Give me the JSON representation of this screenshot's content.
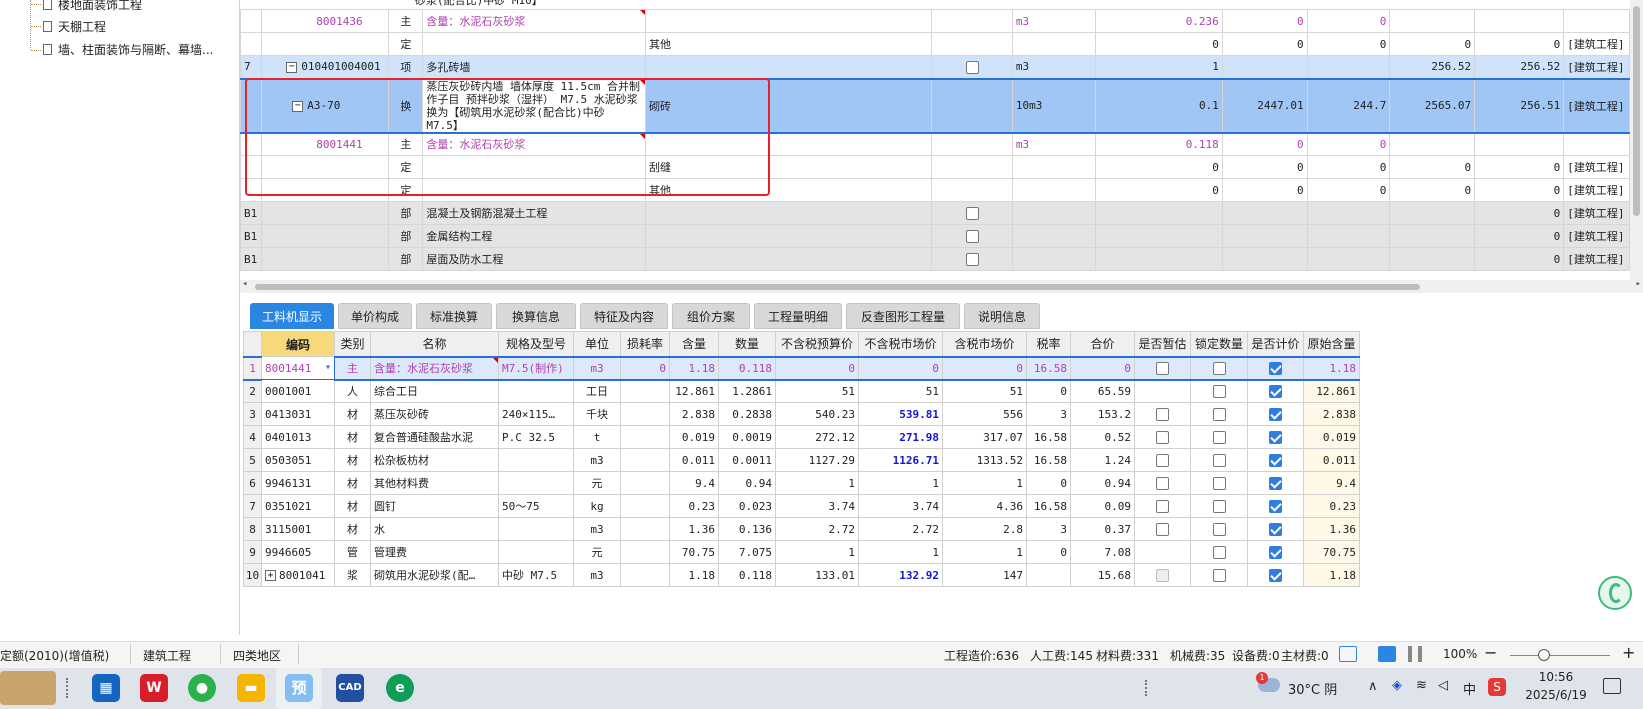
{
  "left_tree": {
    "items": [
      "楼地面装饰工程",
      "天棚工程",
      "墙、柱面装饰与隔断、幕墙..."
    ]
  },
  "top_grid": {
    "rows": [
      {
        "no": "",
        "code": "8001436",
        "type": "主",
        "name": "含量：水泥石灰砂浆",
        "spec": "",
        "unit": "m3",
        "qty": "0.236",
        "v1": "0",
        "v2": "0",
        "v3": "",
        "v4": "",
        "cat": "",
        "style": "sub"
      },
      {
        "no": "",
        "code": "",
        "type": "定",
        "name": "",
        "spec": "其他",
        "unit": "",
        "qty": "0",
        "v1": "0",
        "v2": "0",
        "v3": "0",
        "v4": "0",
        "cat": "[建筑工程]",
        "style": "normal"
      },
      {
        "no": "7",
        "code": "010401004001",
        "type": "项",
        "name": "多孔砖墙",
        "spec": "",
        "unit": "m3",
        "qty": "1",
        "v1": "",
        "v2": "",
        "v3": "256.52",
        "v4": "256.52",
        "cat": "[建筑工程]",
        "style": "blue",
        "check": true
      },
      {
        "no": "",
        "code": "A3-70",
        "type": "换",
        "name": "蒸压灰砂砖内墙 墙体厚度 11.5cm 合并制作子目 预拌砂浆（湿拌） M7.5 水泥砂浆 换为【砌筑用水泥砂浆(配合比)中砂 M7.5】",
        "spec": "砌砖",
        "unit": "10m3",
        "qty": "0.1",
        "v1": "2447.01",
        "v2": "244.7",
        "v3": "2565.07",
        "v4": "256.51",
        "cat": "[建筑工程]",
        "style": "selected"
      },
      {
        "no": "",
        "code": "8001441",
        "type": "主",
        "name": "含量：水泥石灰砂浆",
        "spec": "",
        "unit": "m3",
        "qty": "0.118",
        "v1": "0",
        "v2": "0",
        "v3": "",
        "v4": "",
        "cat": "",
        "style": "sub"
      },
      {
        "no": "",
        "code": "",
        "type": "定",
        "name": "",
        "spec": "刮缝",
        "unit": "",
        "qty": "0",
        "v1": "0",
        "v2": "0",
        "v3": "0",
        "v4": "0",
        "cat": "[建筑工程]",
        "style": "normal"
      },
      {
        "no": "",
        "code": "",
        "type": "定",
        "name": "",
        "spec": "其他",
        "unit": "",
        "qty": "0",
        "v1": "0",
        "v2": "0",
        "v3": "0",
        "v4": "0",
        "cat": "[建筑工程]",
        "style": "normal"
      },
      {
        "no": "B1",
        "code": "",
        "type": "部",
        "name": "混凝土及钢筋混凝土工程",
        "spec": "",
        "unit": "",
        "qty": "",
        "v1": "",
        "v2": "",
        "v3": "",
        "v4": "0",
        "cat": "[建筑工程]",
        "style": "gray",
        "check": true
      },
      {
        "no": "B1",
        "code": "",
        "type": "部",
        "name": "金属结构工程",
        "spec": "",
        "unit": "",
        "qty": "",
        "v1": "",
        "v2": "",
        "v3": "",
        "v4": "0",
        "cat": "[建筑工程]",
        "style": "gray",
        "check": true
      },
      {
        "no": "B1",
        "code": "",
        "type": "部",
        "name": "屋面及防水工程",
        "spec": "",
        "unit": "",
        "qty": "",
        "v1": "",
        "v2": "",
        "v3": "",
        "v4": "0",
        "cat": "[建筑工程]",
        "style": "gray",
        "check": true
      }
    ],
    "top_fragment": "砂浆(配合比)中砂 M10】"
  },
  "tabs": [
    "工料机显示",
    "单价构成",
    "标准换算",
    "换算信息",
    "特征及内容",
    "组价方案",
    "工程量明细",
    "反查图形工程量",
    "说明信息"
  ],
  "bottom_grid": {
    "headers": [
      "",
      "编码",
      "类别",
      "名称",
      "规格及型号",
      "单位",
      "损耗率",
      "含量",
      "数量",
      "不含税预算价",
      "不含税市场价",
      "含税市场价",
      "税率",
      "合价",
      "是否暂估",
      "锁定数量",
      "是否计价",
      "原始含量"
    ],
    "rows": [
      {
        "n": "1",
        "code": "8001441",
        "type": "主",
        "name": "含量：水泥石灰砂浆",
        "spec": "M7.5(制作)",
        "unit": "m3",
        "loss": "0",
        "content": "1.18",
        "qty": "0.118",
        "budget": "0",
        "market": "0",
        "taxmarket": "0",
        "rate": "16.58",
        "total": "0",
        "est": false,
        "lock": false,
        "price": true,
        "orig": "1.18"
      },
      {
        "n": "2",
        "code": "0001001",
        "type": "人",
        "name": "综合工日",
        "spec": "",
        "unit": "工日",
        "loss": "",
        "content": "12.861",
        "qty": "1.2861",
        "budget": "51",
        "market": "51",
        "taxmarket": "51",
        "rate": "0",
        "total": "65.59",
        "est": null,
        "lock": false,
        "price": true,
        "orig": "12.861"
      },
      {
        "n": "3",
        "code": "0413031",
        "type": "材",
        "name": "蒸压灰砂砖",
        "spec": "240×115…",
        "unit": "千块",
        "loss": "",
        "content": "2.838",
        "qty": "0.2838",
        "budget": "540.23",
        "market": "539.81",
        "taxmarket": "556",
        "rate": "3",
        "total": "153.2",
        "est": false,
        "lock": false,
        "price": true,
        "orig": "2.838",
        "bold": true
      },
      {
        "n": "4",
        "code": "0401013",
        "type": "材",
        "name": "复合普通硅酸盐水泥",
        "spec": "P.C 32.5",
        "unit": "t",
        "loss": "",
        "content": "0.019",
        "qty": "0.0019",
        "budget": "272.12",
        "market": "271.98",
        "taxmarket": "317.07",
        "rate": "16.58",
        "total": "0.52",
        "est": false,
        "lock": false,
        "price": true,
        "orig": "0.019",
        "bold": true
      },
      {
        "n": "5",
        "code": "0503051",
        "type": "材",
        "name": "松杂板枋材",
        "spec": "",
        "unit": "m3",
        "loss": "",
        "content": "0.011",
        "qty": "0.0011",
        "budget": "1127.29",
        "market": "1126.71",
        "taxmarket": "1313.52",
        "rate": "16.58",
        "total": "1.24",
        "est": false,
        "lock": false,
        "price": true,
        "orig": "0.011",
        "bold": true
      },
      {
        "n": "6",
        "code": "9946131",
        "type": "材",
        "name": "其他材料费",
        "spec": "",
        "unit": "元",
        "loss": "",
        "content": "9.4",
        "qty": "0.94",
        "budget": "1",
        "market": "1",
        "taxmarket": "1",
        "rate": "0",
        "total": "0.94",
        "est": false,
        "lock": false,
        "price": true,
        "orig": "9.4"
      },
      {
        "n": "7",
        "code": "0351021",
        "type": "材",
        "name": "圆钉",
        "spec": "50～75",
        "unit": "kg",
        "loss": "",
        "content": "0.23",
        "qty": "0.023",
        "budget": "3.74",
        "market": "3.74",
        "taxmarket": "4.36",
        "rate": "16.58",
        "total": "0.09",
        "est": false,
        "lock": false,
        "price": true,
        "orig": "0.23"
      },
      {
        "n": "8",
        "code": "3115001",
        "type": "材",
        "name": "水",
        "spec": "",
        "unit": "m3",
        "loss": "",
        "content": "1.36",
        "qty": "0.136",
        "budget": "2.72",
        "market": "2.72",
        "taxmarket": "2.8",
        "rate": "3",
        "total": "0.37",
        "est": false,
        "lock": false,
        "price": true,
        "orig": "1.36"
      },
      {
        "n": "9",
        "code": "9946605",
        "type": "管",
        "name": "管理费",
        "spec": "",
        "unit": "元",
        "loss": "",
        "content": "70.75",
        "qty": "7.075",
        "budget": "1",
        "market": "1",
        "taxmarket": "1",
        "rate": "0",
        "total": "7.08",
        "est": null,
        "lock": false,
        "price": true,
        "orig": "70.75"
      },
      {
        "n": "10",
        "code": "8001041",
        "type": "浆",
        "name": "砌筑用水泥砂浆(配…",
        "spec": "中砂 M7.5",
        "unit": "m3",
        "loss": "",
        "content": "1.18",
        "qty": "0.118",
        "budget": "133.01",
        "market": "132.92",
        "taxmarket": "147",
        "rate": "",
        "total": "15.68",
        "est": "dis",
        "lock": false,
        "price": true,
        "orig": "1.18",
        "bold": true,
        "expand": true
      }
    ]
  },
  "status": {
    "left": "定额(2010)(增值税)",
    "mid1": "建筑工程",
    "mid2": "四类地区",
    "cost": "工程造价:636",
    "labor": "人工费:145",
    "material": "材料费:331",
    "machine": "机械费:35",
    "equip": "设备费:0",
    "main": "主材费:0",
    "zoom": "100%"
  },
  "taskbar": {
    "weather": "30°C 阴",
    "time": "10:56",
    "date": "2025/6/19",
    "ime": "中",
    "notif": "1"
  },
  "colors": {
    "accent": "#2a86e2",
    "purple": "#b040b0",
    "highlight_box": "#e8202a"
  }
}
